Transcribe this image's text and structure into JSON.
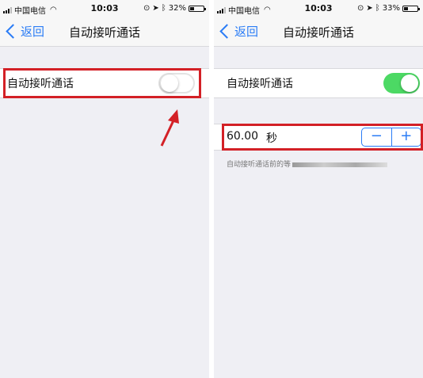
{
  "screens": [
    {
      "status": {
        "carrier": "中国电信",
        "time": "10:03",
        "battery": "32%",
        "battery_level": 0.32
      },
      "nav": {
        "back": "返回",
        "title": "自动接听通话"
      },
      "toggle": {
        "label": "自动接听通话",
        "state": "off"
      }
    },
    {
      "status": {
        "carrier": "中国电信",
        "time": "10:03",
        "battery": "33%",
        "battery_level": 0.33
      },
      "nav": {
        "back": "返回",
        "title": "自动接听通话"
      },
      "toggle": {
        "label": "自动接听通话",
        "state": "on"
      },
      "duration": {
        "value": "60.00",
        "unit": "秒",
        "minus": "−",
        "plus": "+"
      },
      "footnote": "自动接听通话前的等"
    }
  ],
  "colors": {
    "accent": "#2a7cf6",
    "switch_on": "#4cd964",
    "highlight": "#d32026"
  }
}
